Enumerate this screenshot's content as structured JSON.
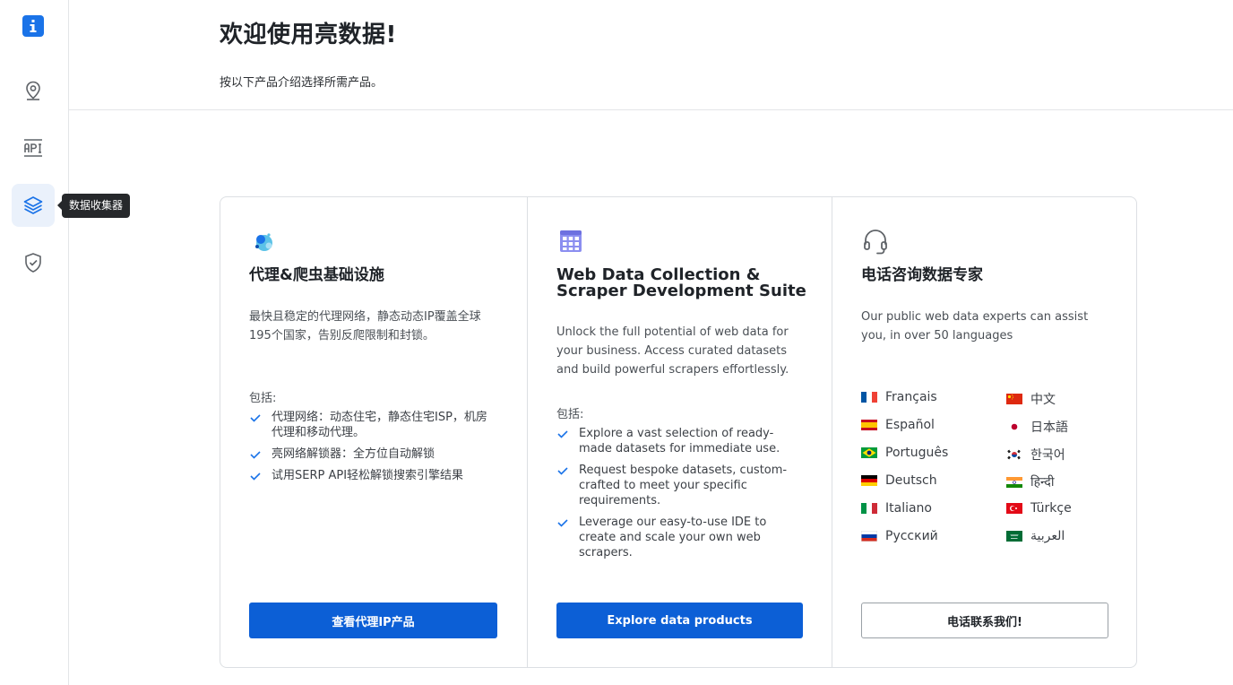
{
  "sidebar": {
    "tooltip": "数据收集器"
  },
  "header": {
    "title": "欢迎使用亮数据!",
    "subtitle": "按以下产品介绍选择所需产品。"
  },
  "cards": [
    {
      "title": "代理&爬虫基础设施",
      "description": "最快且稳定的代理网络，静态动态IP覆盖全球195个国家，告别反爬限制和封锁。",
      "includes_label": "包括:",
      "features": [
        "代理网络：动态住宅，静态住宅ISP，机房代理和移动代理。",
        "亮网络解锁器：全方位自动解锁",
        "试用SERP API轻松解锁搜索引擎结果"
      ],
      "button": "查看代理IP产品"
    },
    {
      "title": "Web Data Collection & Scraper Development Suite",
      "description": "Unlock the full potential of web data for your business. Access curated datasets and build powerful scrapers effortlessly.",
      "includes_label": "包括:",
      "features": [
        "Explore a vast selection of ready-made datasets for immediate use.",
        "Request bespoke datasets, custom-crafted to meet your specific requirements.",
        "Leverage our easy-to-use IDE to create and scale your own web scrapers."
      ],
      "button": "Explore data products"
    },
    {
      "title": "电话咨询数据专家",
      "description": "Our public web data experts can assist you, in over 50 languages",
      "languages": [
        {
          "name": "Français",
          "flag": "fr"
        },
        {
          "name": "中文",
          "flag": "cn"
        },
        {
          "name": "Español",
          "flag": "es"
        },
        {
          "name": "日本語",
          "flag": "jp"
        },
        {
          "name": "Português",
          "flag": "br"
        },
        {
          "name": "한국어",
          "flag": "kr"
        },
        {
          "name": "Deutsch",
          "flag": "de"
        },
        {
          "name": "हिन्दी",
          "flag": "in"
        },
        {
          "name": "Italiano",
          "flag": "it"
        },
        {
          "name": "Türkçe",
          "flag": "tr"
        },
        {
          "name": "Русский",
          "flag": "ru"
        },
        {
          "name": "العربية",
          "flag": "sa"
        }
      ],
      "button": "电话联系我们!"
    }
  ],
  "colors": {
    "primary": "#0c5fd6",
    "logo": "#1a73e8",
    "active_bg": "#eaf1fb",
    "card_border": "#dcdfe3"
  },
  "icons": {
    "logo": "info-icon",
    "nav": [
      "location-pin-icon",
      "api-icon",
      "layers-icon",
      "shield-check-icon"
    ],
    "card_icons": [
      "proxy-globe-icon",
      "data-grid-icon",
      "headset-icon"
    ]
  }
}
